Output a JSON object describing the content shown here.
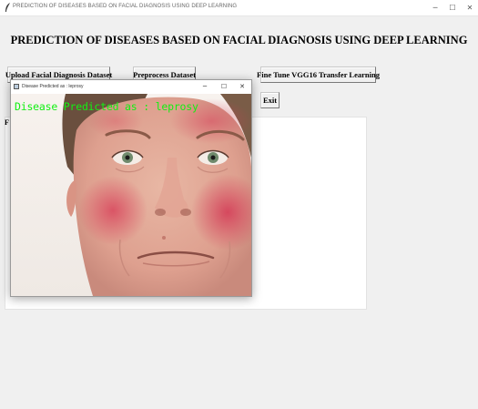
{
  "window": {
    "title": "PREDICTION OF DISEASES BASED ON FACIAL DIAGNOSIS USING DEEP LEARNING",
    "minimize": "─",
    "maximize": "☐",
    "close": "✕"
  },
  "heading": "PREDICTION OF DISEASES BASED ON FACIAL DIAGNOSIS USING DEEP LEARNING",
  "buttons": {
    "upload": "Upload Facial Diagnosis Dataset",
    "preprocess": "Preprocess Dataset",
    "finetune": "Fine Tune VGG16 Transfer Learning",
    "exit": "Exit"
  },
  "output": {
    "visible_text": "F"
  },
  "popup": {
    "title": "Disease Predicted as : leprosy",
    "minimize": "─",
    "maximize": "☐",
    "close": "✕",
    "overlay_text": "Disease Predicted as : leprosy"
  },
  "colors": {
    "overlay_text": "#12f012",
    "background": "#f0f0f0"
  }
}
